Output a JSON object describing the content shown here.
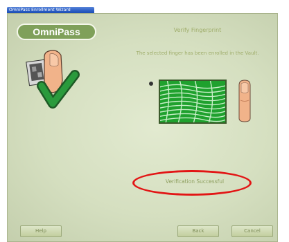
{
  "window": {
    "title": "OmniPass Enrollment Wizard"
  },
  "logo": {
    "text": "OmniPass"
  },
  "page": {
    "title": "Verify Fingerprint",
    "instruction": "The selected finger has been enrolled in the Vault."
  },
  "result": {
    "message": "Verification Successful"
  },
  "buttons": {
    "help": "Help",
    "back": "Back",
    "cancel": "Cancel"
  },
  "colors": {
    "background": "#d5dfc0",
    "accent": "#7fa05a",
    "fingerprint": "#1fa12e",
    "check": "#2a9a3c",
    "highlight": "#e21515"
  },
  "icons": {
    "wizard_art": "finger-check-icon",
    "finger": "finger-icon",
    "capture": "fingerprint-icon"
  }
}
